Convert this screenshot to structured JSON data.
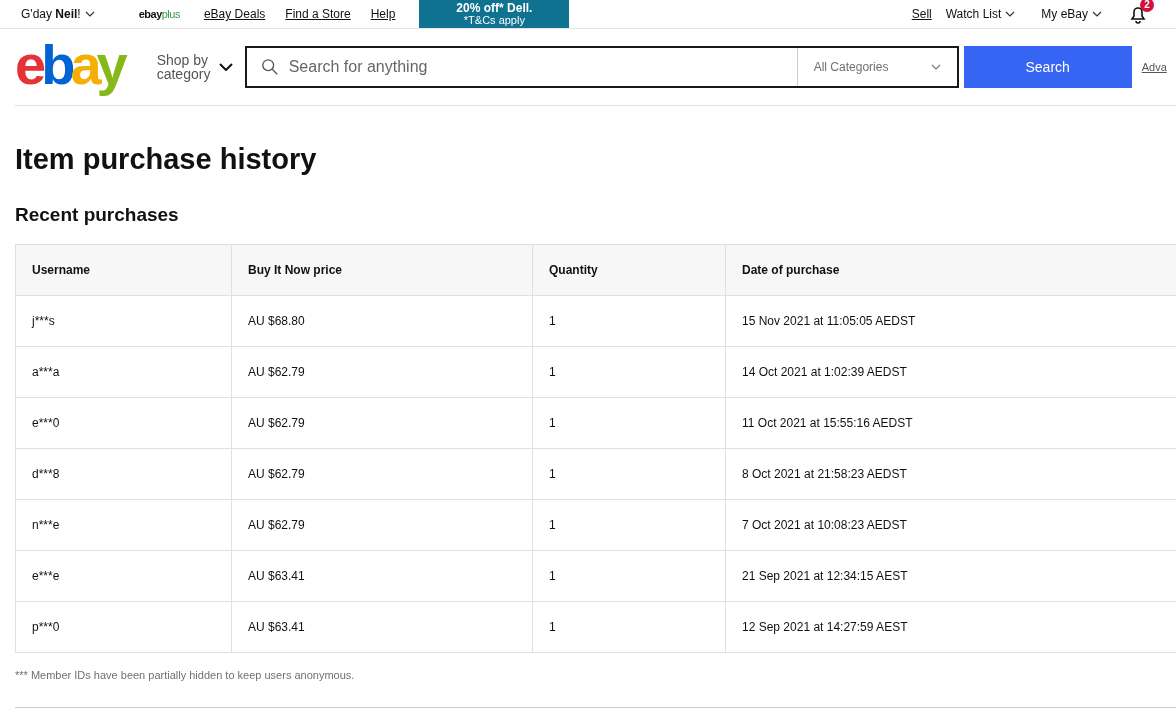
{
  "top_bar": {
    "greeting": "G'day **Neil**!",
    "plus_logo": {
      "brand": "ebay",
      "suffix": "plus"
    },
    "links": [
      "eBay Deals",
      "Find a Store",
      "Help"
    ],
    "promo": {
      "line_1": "20% off* Dell.",
      "line_2": "*T&Cs apply"
    },
    "right_links": [
      {
        "label": "Sell",
        "kind": "link"
      },
      {
        "label": "Watch List",
        "kind": "menu"
      },
      {
        "label": "My eBay",
        "kind": "menu"
      }
    ],
    "notifications": {
      "count": "2"
    }
  },
  "header": {
    "logo": [
      {
        "letter": "e",
        "color": "#e53238"
      },
      {
        "letter": "b",
        "color": "#0064d2"
      },
      {
        "letter": "a",
        "color": "#f5af02"
      },
      {
        "letter": "y",
        "color": "#86b817"
      }
    ],
    "shop_by": "Shop by category",
    "search": {
      "placeholder": "Search for anything"
    },
    "category": "All Categories",
    "search_button": "Search",
    "advanced": "Adva"
  },
  "title": "Item purchase history",
  "subtitle": "Recent purchases",
  "table": {
    "columns": [
      "Username",
      "Buy It Now price",
      "Quantity",
      "Date of purchase"
    ],
    "rows": [
      [
        "j***s",
        "AU $68.80",
        "1",
        "15 Nov 2021 at 11:05:05 AEDST"
      ],
      [
        "a***a",
        "AU $62.79",
        "1",
        "14 Oct 2021 at 1:02:39 AEDST"
      ],
      [
        "e***0",
        "AU $62.79",
        "1",
        "11 Oct 2021 at 15:55:16 AEDST"
      ],
      [
        "d***8",
        "AU $62.79",
        "1",
        "8 Oct 2021 at 21:58:23 AEDST"
      ],
      [
        "n***e",
        "AU $62.79",
        "1",
        "7 Oct 2021 at 10:08:23 AEDST"
      ],
      [
        "e***e",
        "AU $63.41",
        "1",
        "21 Sep 2021 at 12:34:15 AEST"
      ],
      [
        "p***0",
        "AU $63.41",
        "1",
        "12 Sep 2021 at 14:27:59 AEST"
      ]
    ]
  },
  "footnote": "*** Member IDs have been partially hidden to keep users anonymous."
}
